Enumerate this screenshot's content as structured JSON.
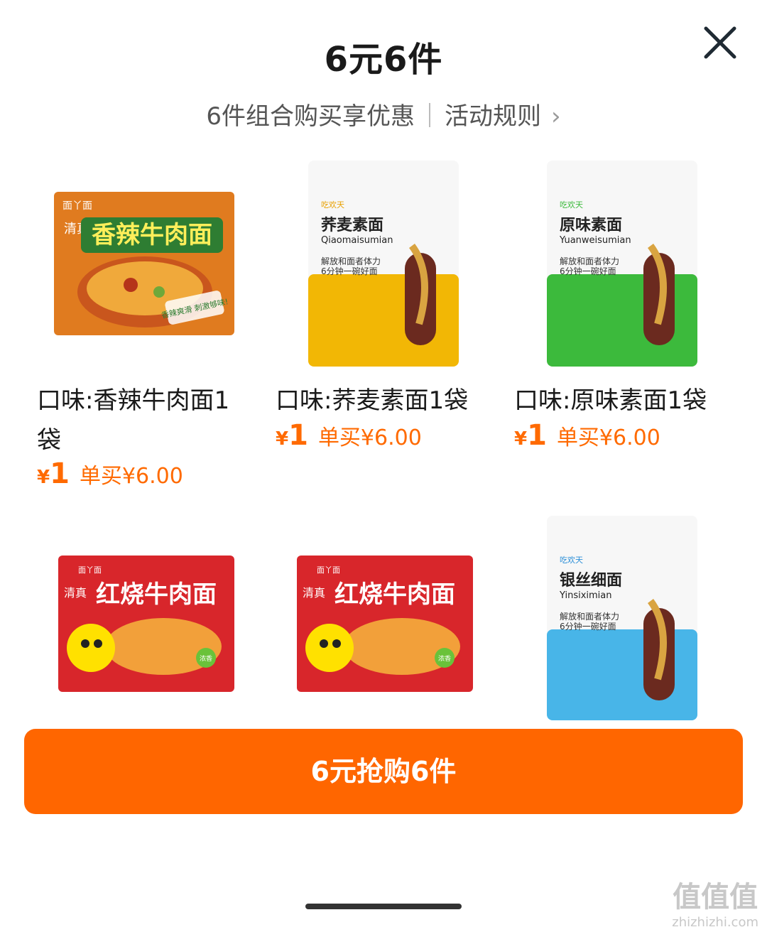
{
  "header": {
    "title": "6元6件",
    "subtitle": "6件组合购买享优惠",
    "rules_link": "活动规则"
  },
  "products": [
    {
      "name": "口味:香辣牛肉面1袋",
      "currency": "¥",
      "price": "1",
      "original": "单买¥6.00",
      "package": {
        "brand": "面丫面",
        "halal": "清真",
        "title": "香辣牛肉面",
        "tagline": "香辣爽滑 刺激够味!",
        "color": "#e07b1f"
      }
    },
    {
      "name": "口味:荞麦素面1袋",
      "currency": "¥",
      "price": "1",
      "original": "单买¥6.00",
      "package": {
        "brand": "吃欢天",
        "title": "荞麦素面",
        "pinyin": "Qiaomaisumian",
        "slogan1": "解放和面者体力",
        "slogan2": "6分钟一碗好面",
        "color": "#f2b705"
      }
    },
    {
      "name": "口味:原味素面1袋",
      "currency": "¥",
      "price": "1",
      "original": "单买¥6.00",
      "package": {
        "brand": "吃欢天",
        "title": "原味素面",
        "pinyin": "Yuanweisumian",
        "slogan1": "解放和面者体力",
        "slogan2": "6分钟一碗好面",
        "color": "#3cba3c"
      }
    },
    {
      "package": {
        "brand": "面丫面",
        "halal": "清真",
        "title": "红烧牛肉面",
        "tag": "浓香",
        "color": "#d8262b"
      }
    },
    {
      "package": {
        "brand": "面丫面",
        "halal": "清真",
        "title": "红烧牛肉面",
        "tag": "浓香",
        "color": "#d8262b"
      }
    },
    {
      "package": {
        "brand": "吃欢天",
        "title": "银丝细面",
        "pinyin": "Yinsiximian",
        "slogan1": "解放和面者体力",
        "slogan2": "6分钟一碗好面",
        "color": "#48b5e8"
      }
    }
  ],
  "buy_button": "6元抢购6件",
  "watermark": {
    "main": "值值值",
    "url": "zhizhizhi.com"
  },
  "colors": {
    "accent": "#ff6600"
  }
}
